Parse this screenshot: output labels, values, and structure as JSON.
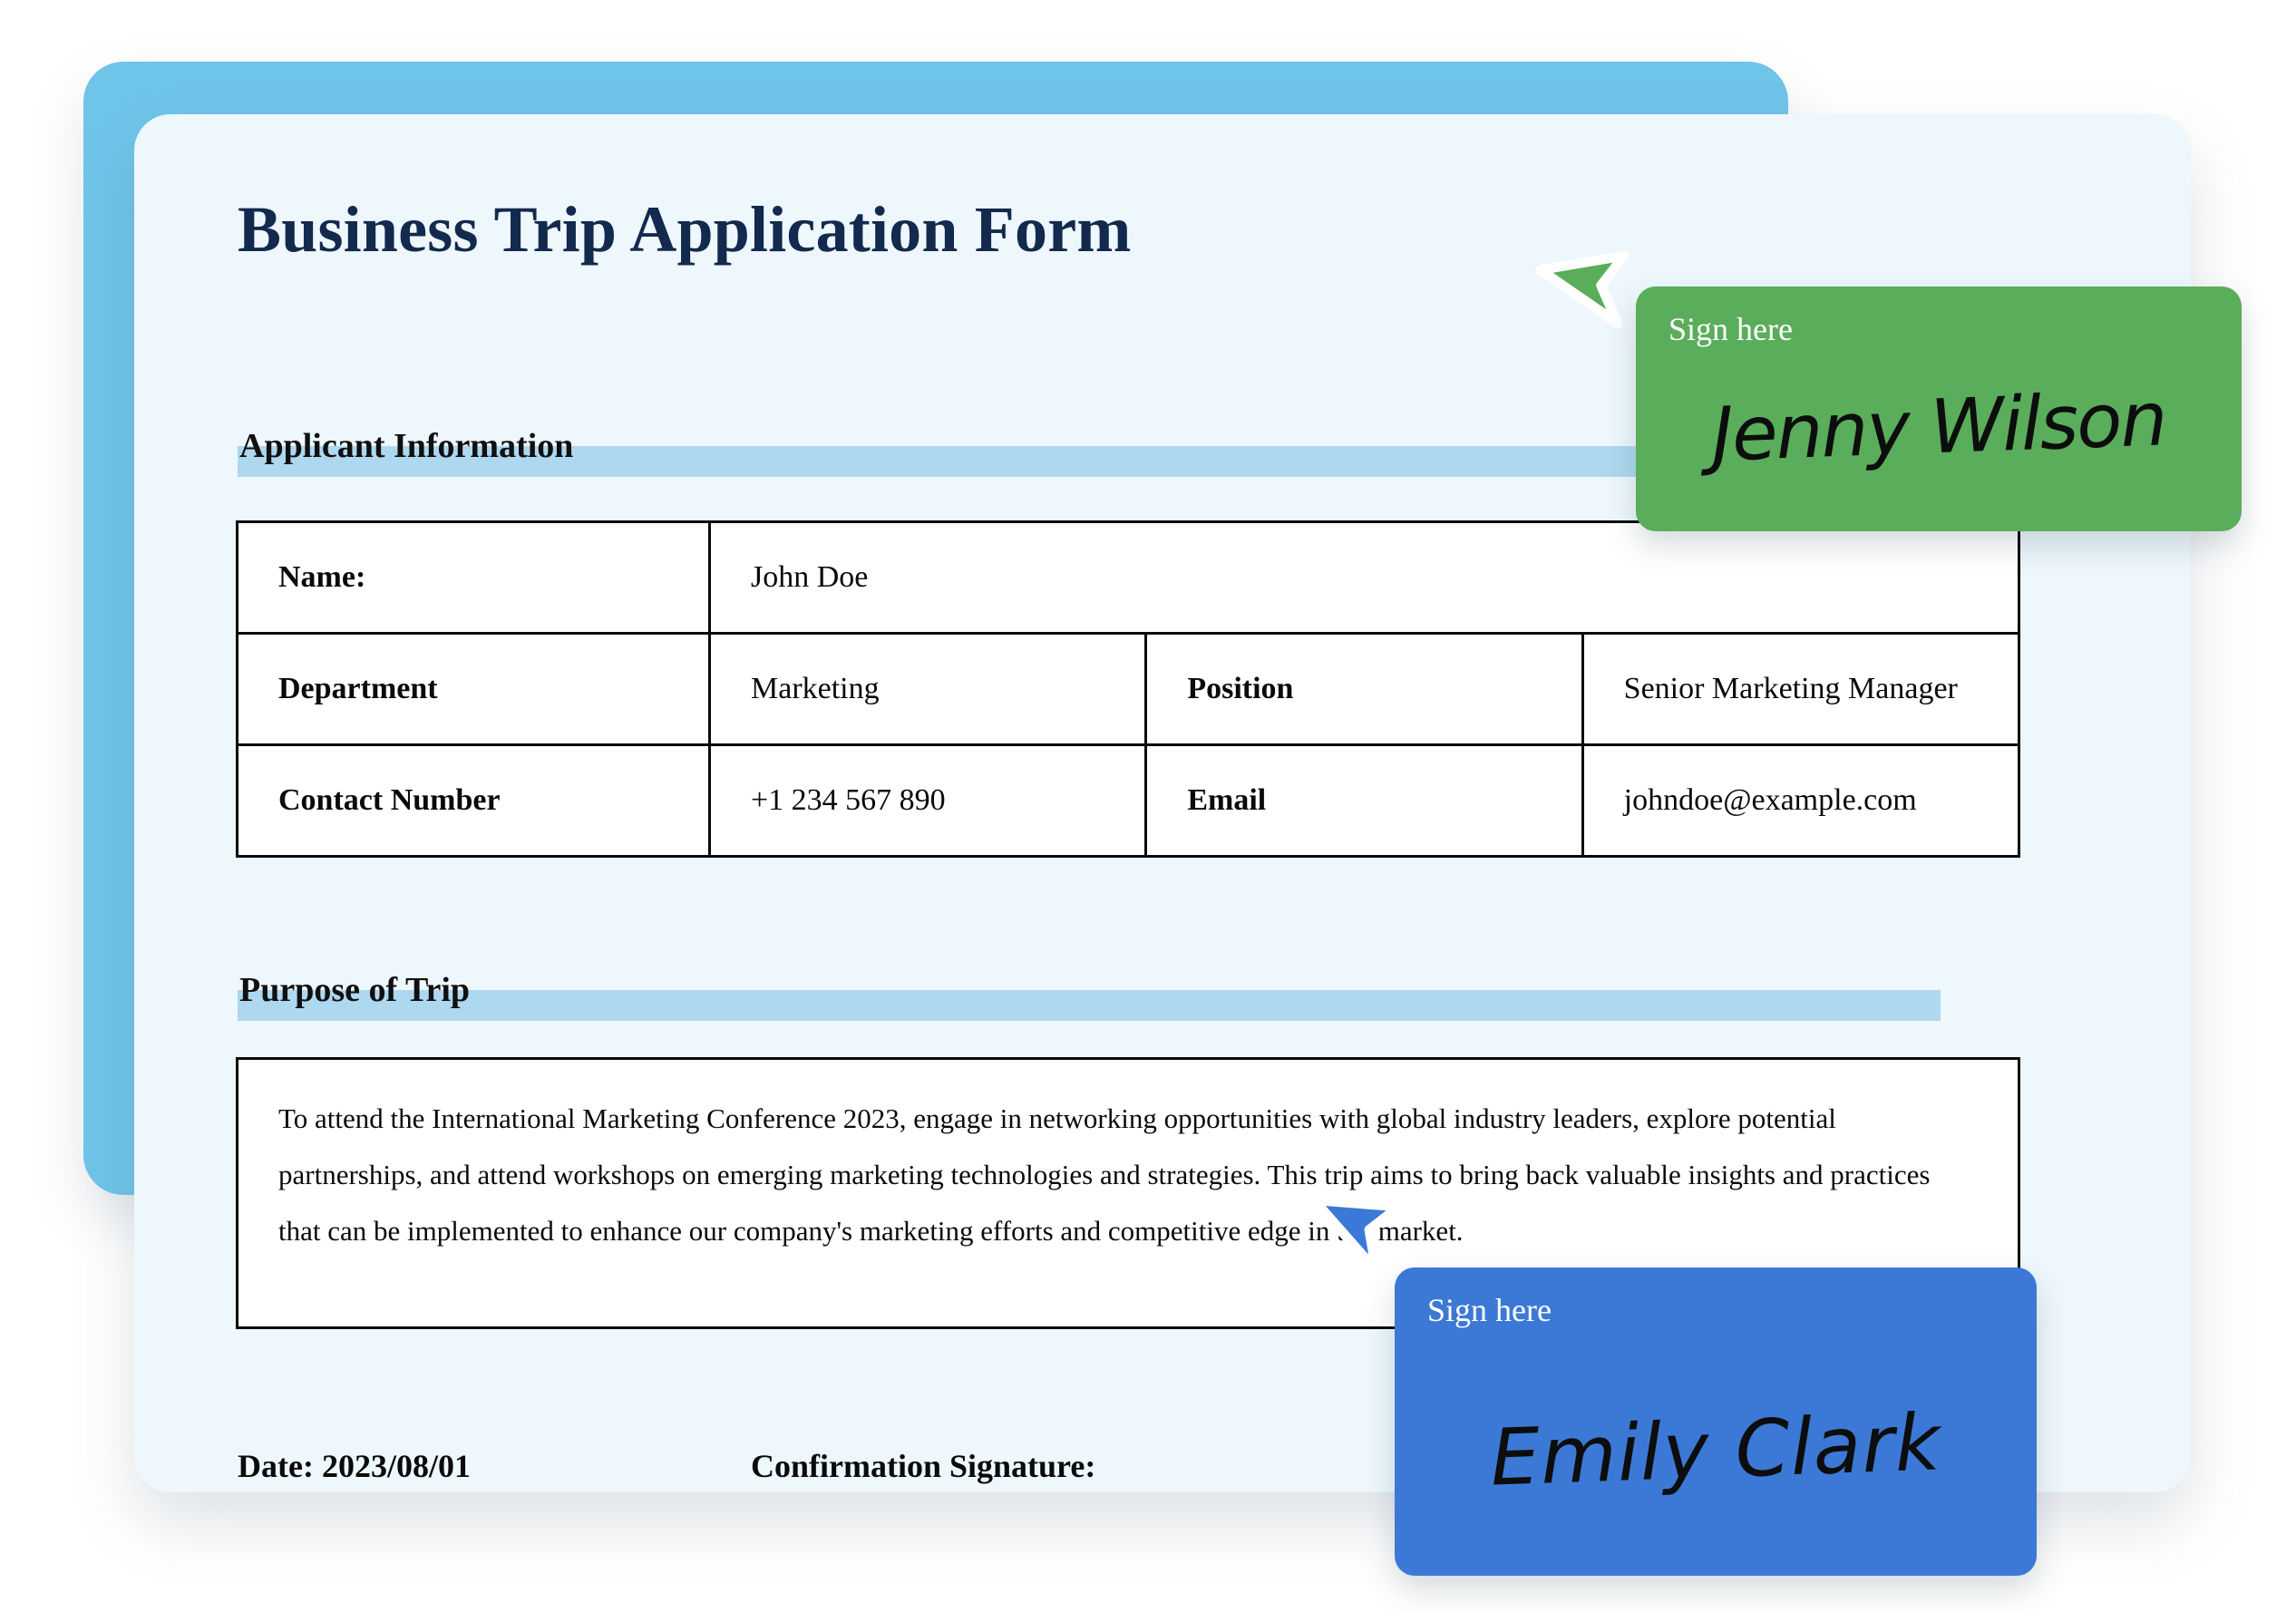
{
  "document": {
    "title": "Business Trip Application Form",
    "sections": {
      "applicant": "Applicant Information",
      "purpose": "Purpose of Trip"
    },
    "applicant_table": {
      "rows": [
        {
          "label1": "Name:",
          "value1": "John Doe",
          "label2": "",
          "value2": ""
        },
        {
          "label1": "Department",
          "value1": "Marketing",
          "label2": "Position",
          "value2": "Senior Marketing Manager"
        },
        {
          "label1": "Contact Number",
          "value1": "+1 234 567 890",
          "label2": "Email",
          "value2": "johndoe@example.com"
        }
      ]
    },
    "purpose_text": "To attend the International Marketing Conference 2023, engage in networking opportunities with global industry leaders, explore potential partnerships, and attend workshops on emerging marketing technologies and strategies. This trip aims to bring back valuable insights and practices that can be implemented to enhance our company's marketing efforts and competitive edge in the market.",
    "footer": {
      "date": "Date: 2023/08/01",
      "signature_label": "Confirmation Signature:"
    }
  },
  "signature_cards": [
    {
      "id": "green",
      "prompt": "Sign here",
      "signature": "Jenny Wilson",
      "color": "#5aad5a",
      "cursor_color": "#5aad5a"
    },
    {
      "id": "blue",
      "prompt": "Sign here",
      "signature": "Emily Clark",
      "color": "#3c79d6",
      "cursor_color": "#3c79d6"
    }
  ],
  "theme": {
    "backing_card": "#6fc4ea",
    "document_card": "#edf7fc",
    "highlight_bar": "#aed8ef",
    "title_color": "#13294d",
    "border_color": "#0a0a0a",
    "page_background": "#ffffff"
  }
}
